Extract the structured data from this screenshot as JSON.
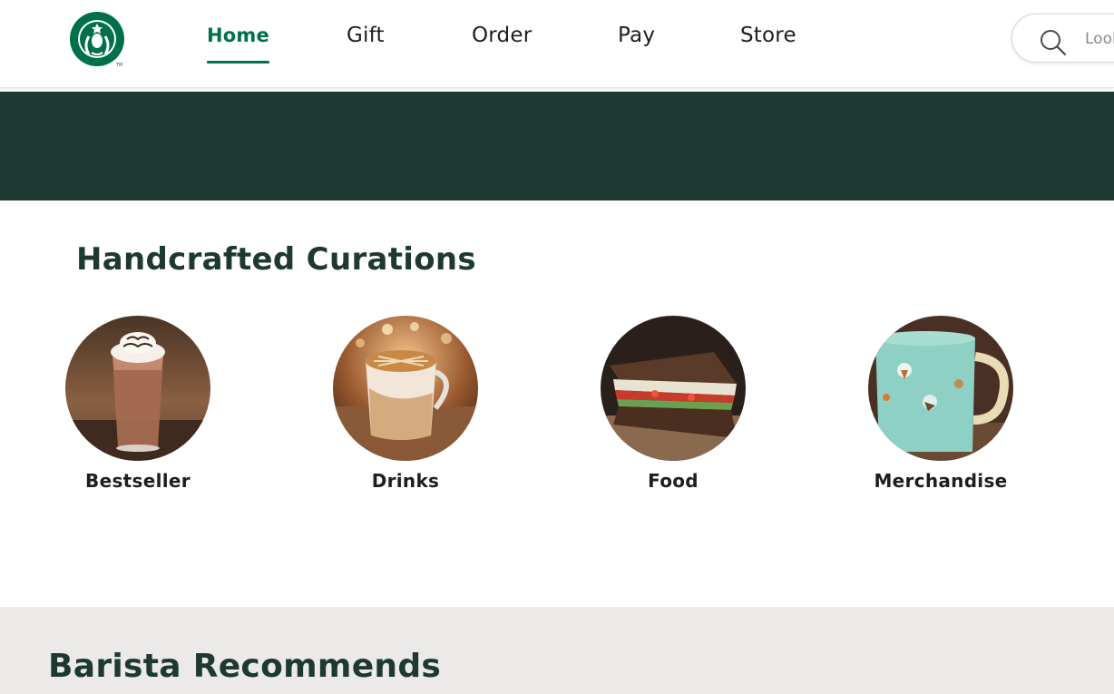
{
  "brand": {
    "name": "Starbucks",
    "logo_icon": "siren-logo-icon",
    "primary_color": "#00704a",
    "dark_green": "#1e3932"
  },
  "nav": {
    "items": [
      {
        "label": "Home",
        "active": true
      },
      {
        "label": "Gift",
        "active": false
      },
      {
        "label": "Order",
        "active": false
      },
      {
        "label": "Pay",
        "active": false
      },
      {
        "label": "Store",
        "active": false
      }
    ]
  },
  "search": {
    "placeholder": "Looking for something?",
    "icon": "search-icon"
  },
  "curations": {
    "title": "Handcrafted Curations",
    "categories": [
      {
        "label": "Bestseller",
        "image": "frappuccino-drink"
      },
      {
        "label": "Drinks",
        "image": "latte-mug"
      },
      {
        "label": "Food",
        "image": "sandwich"
      },
      {
        "label": "Merchandise",
        "image": "teal-mug"
      }
    ]
  },
  "barista": {
    "title": "Barista Recommends"
  }
}
